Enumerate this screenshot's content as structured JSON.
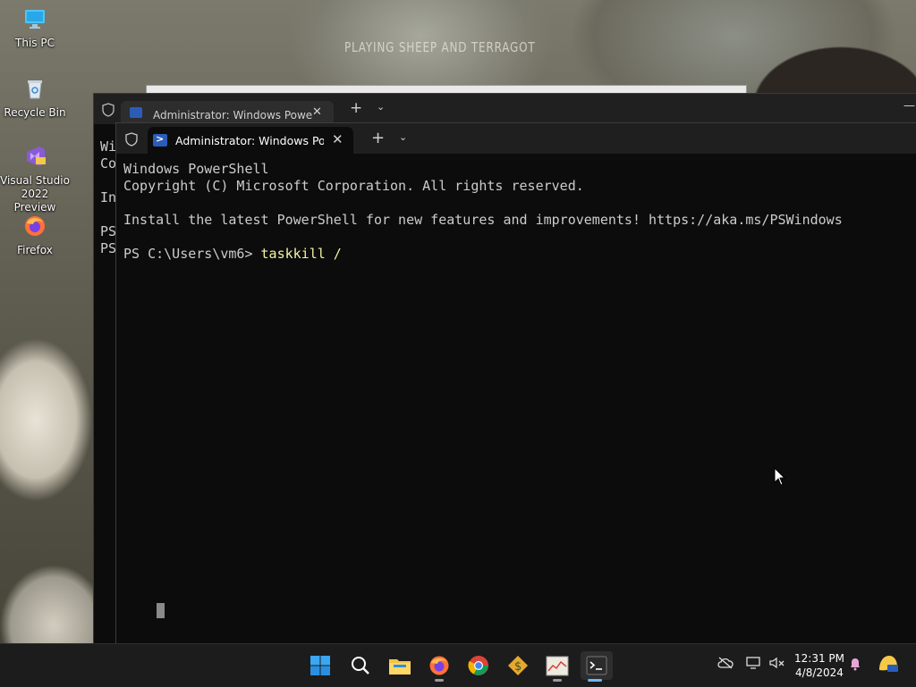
{
  "desktop": {
    "wallpaper_caption": "PLAYING SHEEP AND TERRAGOT",
    "icons": [
      {
        "label": "This PC"
      },
      {
        "label": "Recycle Bin"
      },
      {
        "label": "Visual Studio 2022 Preview"
      },
      {
        "label": "Firefox"
      }
    ]
  },
  "background_window": {
    "tab_title": "Administrator: Windows Powe",
    "visible_text": "Wi\nCo\n\nIn\n\nPS\nPS"
  },
  "terminal": {
    "tab_title": "Administrator: Windows PowerShell",
    "close_glyph": "✕",
    "new_tab_glyph": "+",
    "dropdown_glyph": "⌄",
    "lines": {
      "line1": "Windows PowerShell",
      "line2": "Copyright (C) Microsoft Corporation. All rights reserved.",
      "line3": "Install the latest PowerShell for new features and improvements! https://aka.ms/PSWindows",
      "prompt": "PS C:\\Users\\vm6> ",
      "command": "taskkill /"
    }
  },
  "taskbar": {
    "apps": [
      "start",
      "search",
      "file-explorer",
      "firefox",
      "chrome",
      "app-money",
      "app-chart",
      "terminal"
    ],
    "clock_time": "12:31 PM",
    "clock_date": "4/8/2024",
    "accent_color": "#6fb6ff"
  }
}
